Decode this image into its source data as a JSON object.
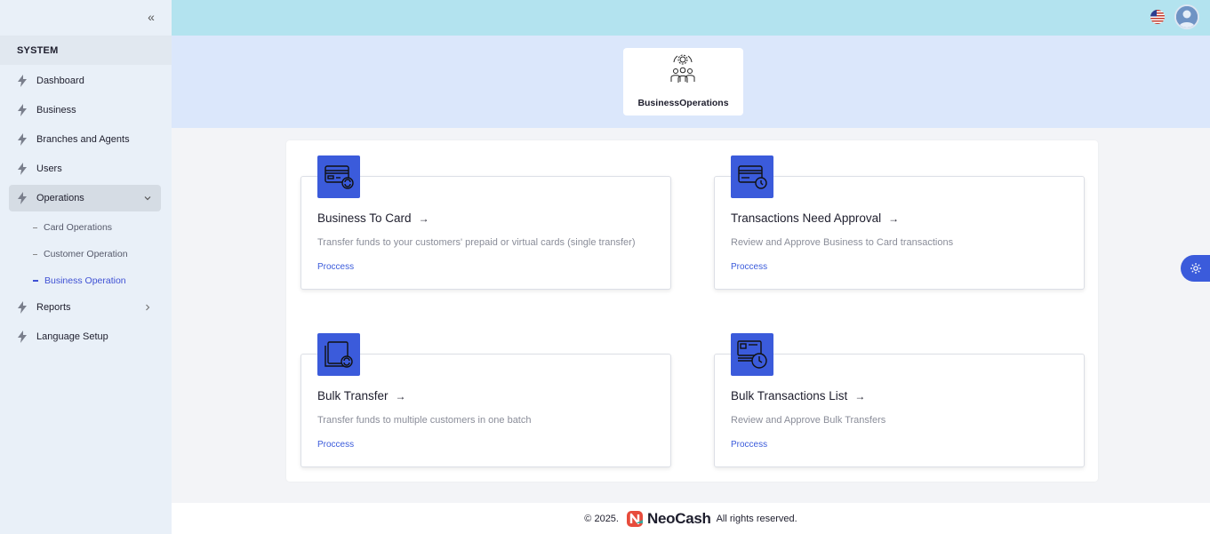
{
  "sidebar": {
    "section": "SYSTEM",
    "items": [
      {
        "label": "Dashboard"
      },
      {
        "label": "Business"
      },
      {
        "label": "Branches and Agents"
      },
      {
        "label": "Users"
      },
      {
        "label": "Operations"
      },
      {
        "label": "Reports"
      },
      {
        "label": "Language Setup"
      }
    ],
    "sub_items": [
      {
        "label": "Card Operations"
      },
      {
        "label": "Customer Operation"
      },
      {
        "label": "Business Operation"
      }
    ]
  },
  "hero": {
    "title": "BusinessOperations"
  },
  "cards": [
    {
      "title": "Business To Card",
      "description": "Transfer funds to your customers' prepaid or virtual cards (single transfer)",
      "link": "Proccess",
      "icon": "credit-card-sync-icon"
    },
    {
      "title": "Transactions Need Approval",
      "description": "Review and Approve Business to Card transactions",
      "link": "Proccess",
      "icon": "credit-card-clock-icon"
    },
    {
      "title": "Bulk Transfer",
      "description": "Transfer funds to multiple customers in one batch",
      "link": "Proccess",
      "icon": "cards-stack-sync-icon"
    },
    {
      "title": "Bulk Transactions List",
      "description": "Review and Approve Bulk Transfers",
      "link": "Proccess",
      "icon": "cards-stack-clock-icon"
    }
  ],
  "footer": {
    "copyright": "© 2025.",
    "brand": "NeoCash",
    "rights": "All rights reserved."
  },
  "colors": {
    "accent": "#3b5bdb",
    "topbar": "#b3e3ef",
    "hero": "#dbe7fb",
    "sidebar": "#e9f0f8"
  }
}
